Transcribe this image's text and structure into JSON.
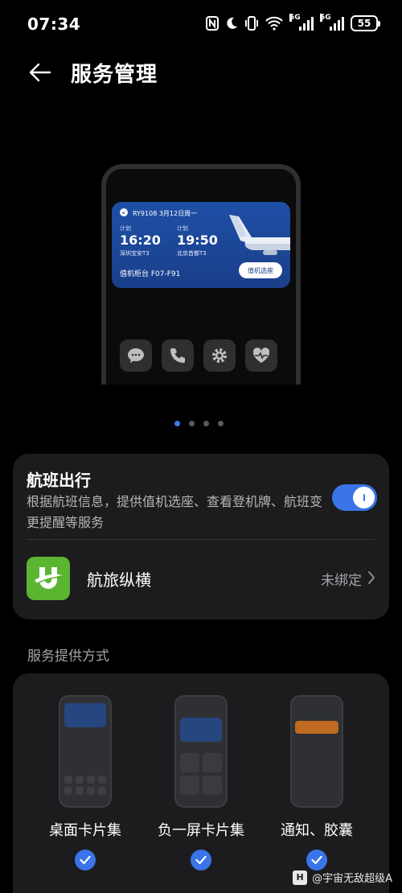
{
  "status_bar": {
    "time": "07:34",
    "signal1_tag": "5G",
    "signal2_tag": "5G",
    "battery": "55",
    "icons": [
      "nfc-icon",
      "moon-icon",
      "vibrate-icon",
      "wifi-icon",
      "signal-icon",
      "signal-icon",
      "battery-icon"
    ]
  },
  "header": {
    "title": "服务管理",
    "back_icon": "back-arrow-icon"
  },
  "preview": {
    "flight_card": {
      "flight_info": "RY9108 3月12日周一",
      "dep_label": "计划",
      "dep_time": "16:20",
      "dep_airport": "深圳宝安T3",
      "arr_label": "计划",
      "arr_time": "19:50",
      "arr_airport": "北京首都T3",
      "counter": "值机柜台  F07-F91",
      "checkin_button": "值机选座",
      "accent": "#1e4fa6"
    },
    "apps": [
      "message-icon",
      "phone-icon",
      "settings-icon",
      "health-icon"
    ],
    "pager": {
      "total": 4,
      "active": 1
    }
  },
  "service": {
    "title": "航班出行",
    "description": "根据航班信息，提供值机选座、查看登机牌、航班变更提醒等服务",
    "enabled": true,
    "provider": {
      "name": "航旅纵横",
      "status": "未绑定",
      "logo_color": "#5cb531"
    }
  },
  "methods_section": {
    "label": "服务提供方式",
    "items": [
      {
        "name": "桌面卡片集",
        "checked": true
      },
      {
        "name": "负一屏卡片集",
        "checked": true
      },
      {
        "name": "通知、胶囊",
        "checked": true
      }
    ]
  },
  "watermark": "@宇宙无敌超级A",
  "colors": {
    "accent": "#3a74e8",
    "card_bg": "#1c1c1e",
    "background": "#000000"
  }
}
